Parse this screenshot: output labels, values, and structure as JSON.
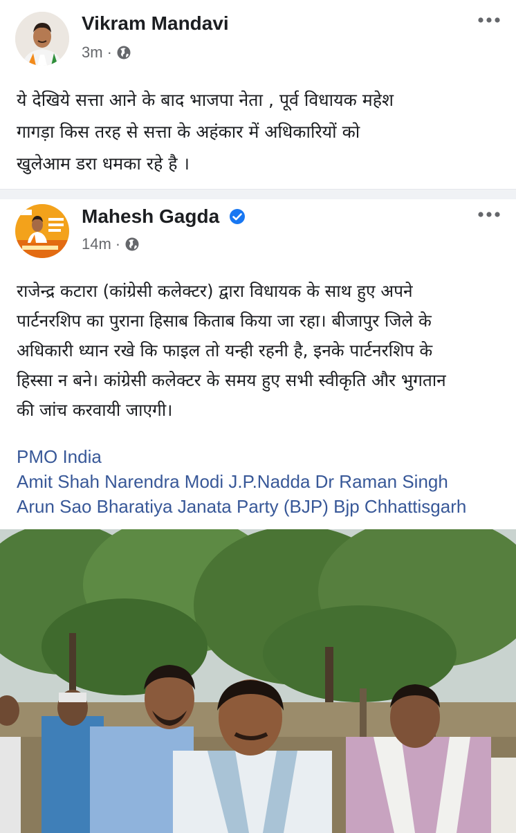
{
  "post": {
    "author": "Vikram Mandavi",
    "time": "3m",
    "text": "ये देखिये सत्ता आने के बाद भाजपा नेता , पूर्व विधायक महेश\nगागड़ा किस तरह से सत्ता के अहंकार में  अधिकारियों को\nखुलेआम डरा धमका रहे है ।"
  },
  "shared_post": {
    "author": "Mahesh Gagda",
    "time": "14m",
    "text": "राजेन्द्र कटारा (कांग्रेसी कलेक्टर) द्वारा विधायक के साथ हुए अपने\nपार्टनरशिप का पुराना हिसाब किताब किया जा रहा। बीजापुर जिले के\nअधिकारी ध्यान रखे कि फाइल तो यन्ही रहनी है, इनके पार्टनरशिप के\nहिस्सा न बने। कांग्रेसी कलेक्टर के समय हुए सभी स्वीकृति और भुगतान\nकी जांच करवायी जाएगी।",
    "tags": [
      "PMO India",
      "Amit Shah Narendra Modi J.P.Nadda Dr Raman Singh",
      "Arun Sao Bharatiya Janata Party (BJP) Bjp Chhattisgarh"
    ]
  },
  "colors": {
    "text": "#1c1e21",
    "meta": "#65676b",
    "link": "#385898",
    "verified": "#1877f2",
    "divider": "#f0f2f5"
  },
  "icons": [
    "globe-icon",
    "more-options-icon",
    "verified-badge-icon"
  ]
}
